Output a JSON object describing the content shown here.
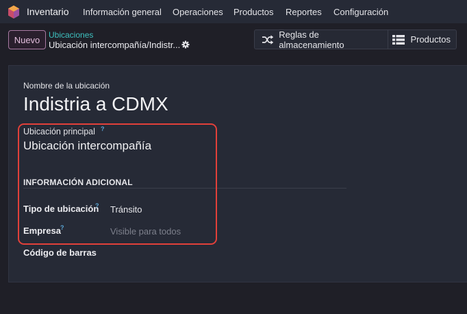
{
  "navbar": {
    "app_name": "Inventario",
    "menu": [
      "Información general",
      "Operaciones",
      "Productos",
      "Reportes",
      "Configuración"
    ]
  },
  "control_panel": {
    "new_button": "Nuevo",
    "breadcrumb_parent": "Ubicaciones",
    "breadcrumb_current": "Ubicación intercompañía/Indistr...",
    "smart_buttons": [
      "Reglas de almacenamiento",
      "Productos"
    ]
  },
  "form": {
    "name_label": "Nombre de la ubicación",
    "name_value": "Indistria a CDMX",
    "parent_label": "Ubicación principal",
    "parent_value": "Ubicación intercompañía",
    "help_mark": "?",
    "section_title": "INFORMACIÓN ADICIONAL",
    "type_label": "Tipo de ubicación",
    "type_value": "Tránsito",
    "company_label": "Empresa",
    "company_placeholder": "Visible para todos",
    "barcode_label": "Código de barras"
  },
  "colors": {
    "accent_teal": "#3ec1c0",
    "highlight_red": "#e2403a",
    "new_button_border": "#a97aa3"
  }
}
